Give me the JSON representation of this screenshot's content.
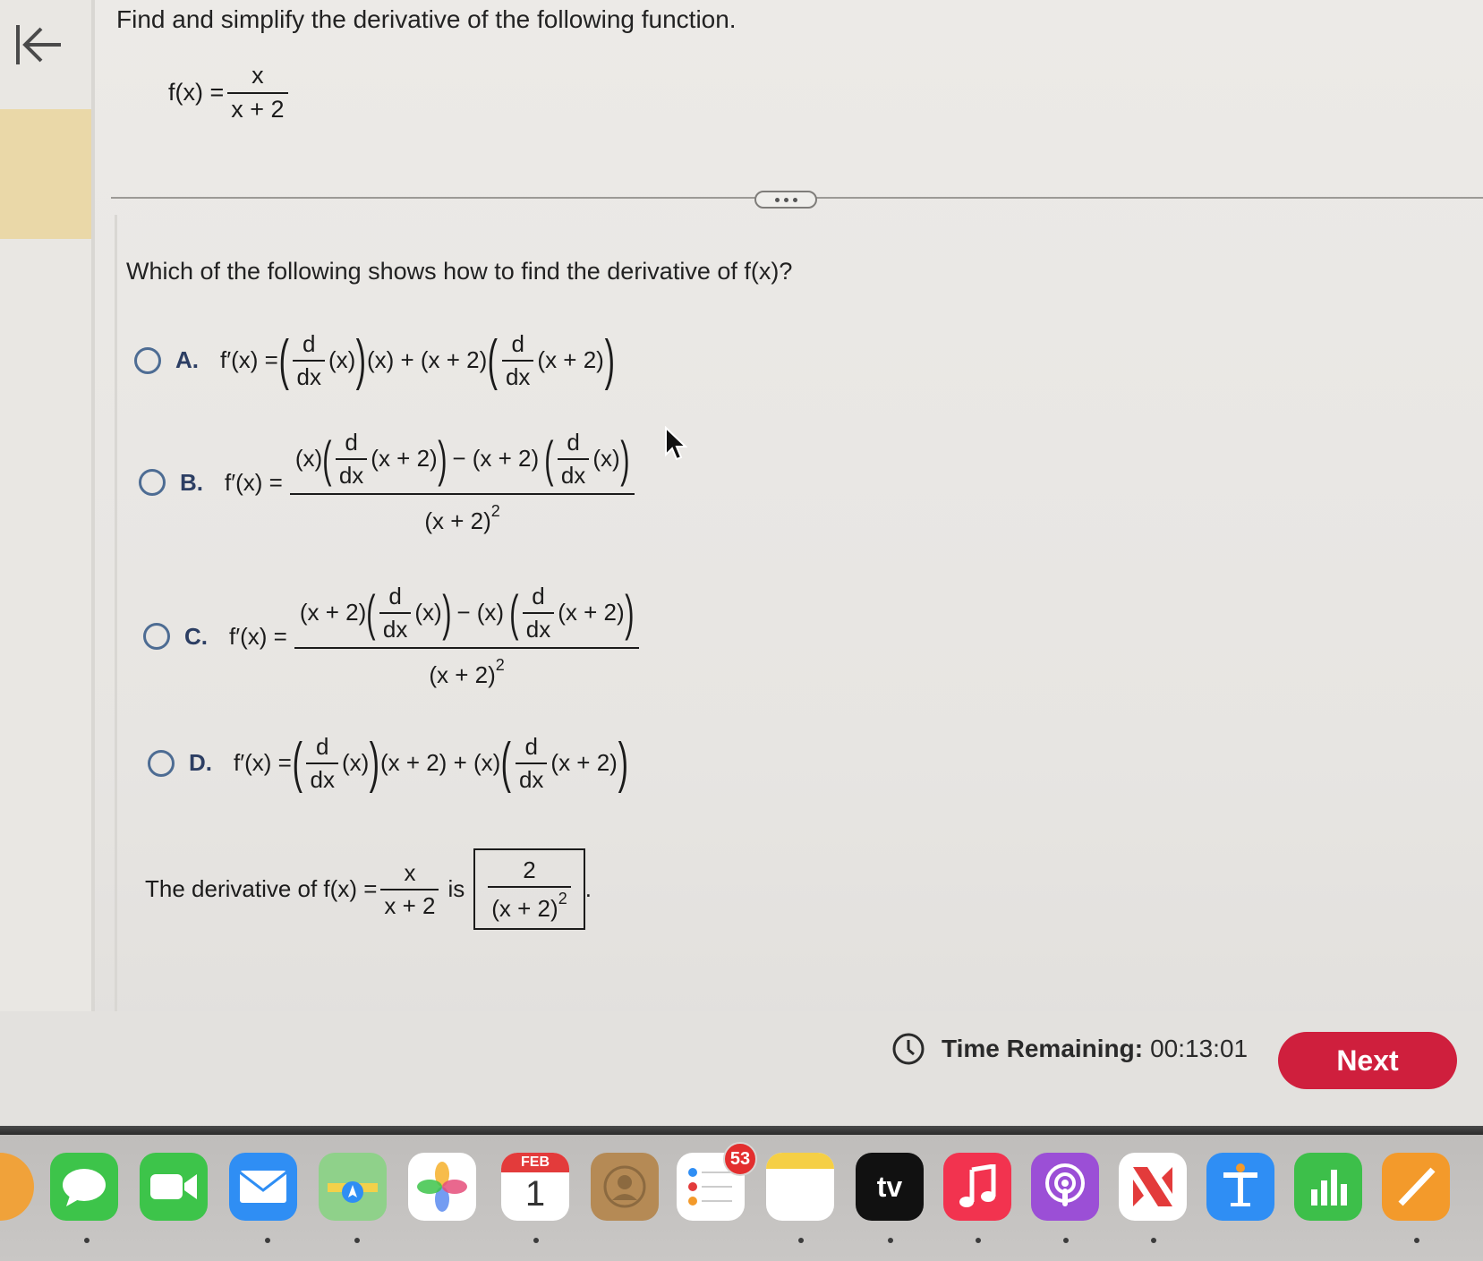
{
  "question": {
    "title": "Find and simplify the derivative of the following function.",
    "function_lhs": "f(x) =",
    "function_num": "x",
    "function_den": "x + 2",
    "prompt": "Which of the following shows how to find the derivative of f(x)?"
  },
  "options": {
    "A": {
      "letter": "A.",
      "lhs": "f′(x) =",
      "t1": "d",
      "t2": "dx",
      "t3": "(x)",
      "t4": "(x) + (x + 2)",
      "t5": "d",
      "t6": "dx",
      "t7": "(x + 2)"
    },
    "B": {
      "letter": "B.",
      "lhs": "f′(x) =",
      "a": "(x)",
      "d1": "d",
      "dx1": "dx",
      "b": "(x + 2)",
      "c": "− (x + 2)",
      "d2": "d",
      "dx2": "dx",
      "e": "(x)",
      "den": "(x + 2)",
      "exp": "2"
    },
    "C": {
      "letter": "C.",
      "lhs": "f′(x) =",
      "a": "(x + 2)",
      "d1": "d",
      "dx1": "dx",
      "b": "(x)",
      "c": "− (x)",
      "d2": "d",
      "dx2": "dx",
      "e": "(x + 2)",
      "den": "(x + 2)",
      "exp": "2"
    },
    "D": {
      "letter": "D.",
      "lhs": "f′(x) =",
      "t1": "d",
      "t2": "dx",
      "t3": "(x)",
      "t4": "(x + 2) + (x)",
      "t5": "d",
      "t6": "dx",
      "t7": "(x + 2)"
    }
  },
  "answer": {
    "prefix": "The derivative of f(x) =",
    "num": "x",
    "den": "x + 2",
    "is": "is",
    "ans_num": "2",
    "ans_den": "(x + 2)",
    "ans_exp": "2",
    "period": "."
  },
  "footer": {
    "timer_label": "Time Remaining:",
    "timer_value": "00:13:01",
    "next_label": "Next"
  },
  "dock": {
    "calendar_month": "FEB",
    "calendar_day": "1",
    "reminders_badge": "53",
    "tv_label": "tv"
  },
  "colors": {
    "next_button": "#cf1f3d",
    "radio": "#4d6c93",
    "accent_strip": "#ead8a8"
  }
}
